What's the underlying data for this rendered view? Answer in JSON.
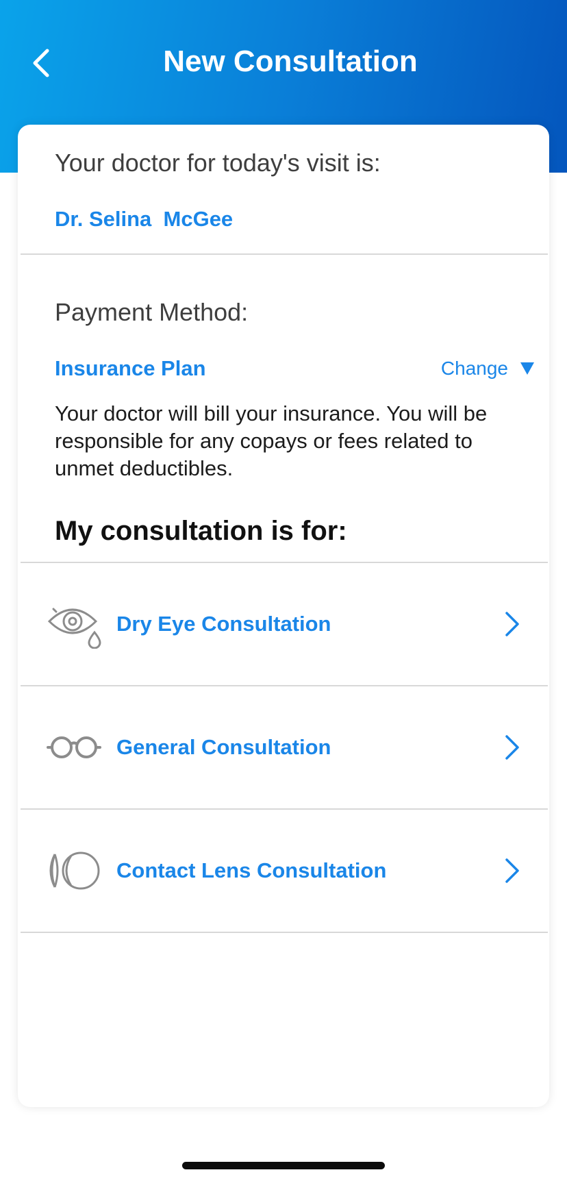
{
  "header": {
    "title": "New Consultation",
    "back_icon": "chevron-left-icon"
  },
  "doctor": {
    "heading": "Your doctor for today's visit is:",
    "name": "Dr. Selina  McGee"
  },
  "payment": {
    "heading": "Payment Method:",
    "plan": "Insurance Plan",
    "change_label": "Change",
    "change_icon": "caret-down-icon",
    "description": "Your doctor will bill your insurance. You will be responsible for any copays or fees related to unmet deductibles."
  },
  "consultation": {
    "heading": "My consultation is for:",
    "options": [
      {
        "label": "Dry Eye Consultation",
        "icon": "dry-eye-icon"
      },
      {
        "label": "General Consultation",
        "icon": "eyeglasses-icon"
      },
      {
        "label": "Contact Lens Consultation",
        "icon": "contact-lens-icon"
      }
    ]
  },
  "colors": {
    "accent": "#1a86e8",
    "header_gradient_start": "#0aa3ea",
    "header_gradient_end": "#0456bd",
    "icon_gray": "#8c8c8c"
  }
}
